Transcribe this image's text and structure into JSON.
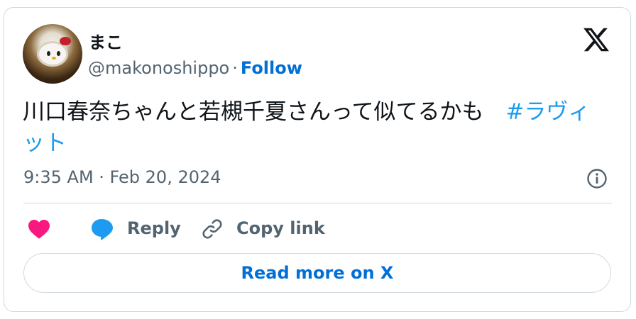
{
  "user": {
    "display_name": "まこ",
    "handle": "@makonoshippo",
    "separator": "·",
    "follow_label": "Follow"
  },
  "tweet": {
    "text": "川口春奈ちゃんと若槻千夏さんって似てるかも　",
    "hashtag": "#ラヴィット",
    "timestamp": "9:35 AM · Feb 20, 2024"
  },
  "actions": {
    "reply_label": "Reply",
    "copy_link_label": "Copy link",
    "read_more_label": "Read more on X"
  },
  "icons": {
    "logo": "x-logo-icon",
    "info": "info-icon",
    "like": "heart-icon",
    "reply": "reply-bubble-icon",
    "copy": "link-icon"
  },
  "colors": {
    "link": "#006fd6",
    "hashtag": "#1d9bf0",
    "heart": "#f91880",
    "reply": "#1d9bf0",
    "muted": "#536471",
    "border": "#cfd9de"
  }
}
